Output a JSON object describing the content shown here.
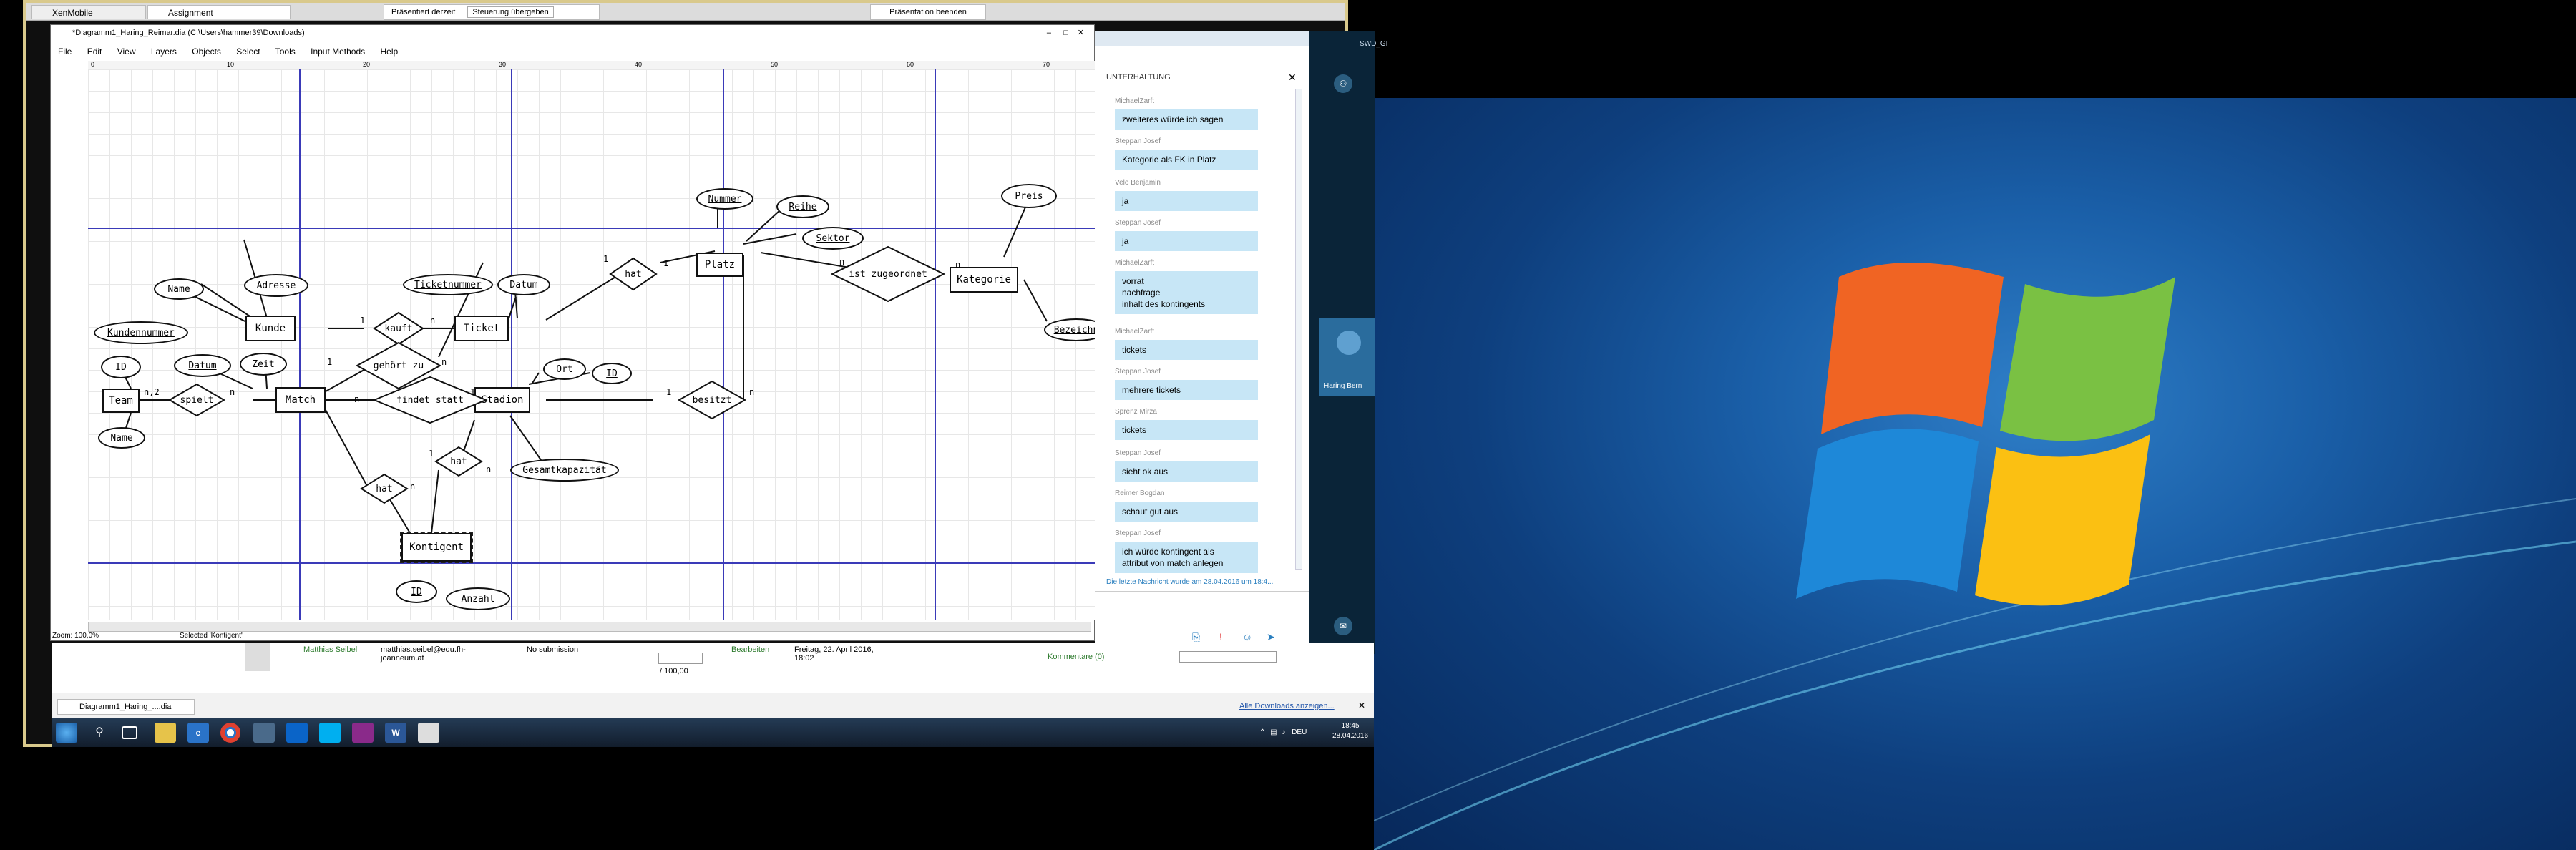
{
  "tabs": [
    "XenMobile",
    "Assignment"
  ],
  "presenter": {
    "label": "Präsentiert derzeit",
    "control": "Steuerung übergeben",
    "end": "Präsentation beenden"
  },
  "dia": {
    "title": "*Diagramm1_Haring_Reimar.dia (C:\\Users\\hammer39\\Downloads)",
    "menu": [
      "File",
      "Edit",
      "View",
      "Layers",
      "Objects",
      "Select",
      "Tools",
      "Input Methods",
      "Help"
    ],
    "ruler": [
      "0",
      "10",
      "20",
      "30",
      "40",
      "50",
      "60",
      "70"
    ],
    "zoom": "Zoom: 100,0%",
    "status": "Selected 'Kontigent'"
  },
  "er": {
    "entities": {
      "team": "Team",
      "match": "Match",
      "kunde": "Kunde",
      "ticket": "Ticket",
      "stadion": "Stadion",
      "platz": "Platz",
      "kategorie": "Kategorie",
      "kontigent": "Kontigent"
    },
    "attributes": {
      "id1": "ID",
      "name1": "Name",
      "datum1": "Datum",
      "zeit": "Zeit",
      "name2": "Name",
      "adresse": "Adresse",
      "kundennummer": "Kundennummer",
      "ticketnummer": "Ticketnummer",
      "datum2": "Datum",
      "ort": "Ort",
      "id2": "ID",
      "gesamtkapazitaet": "Gesamtkapazität",
      "nummer": "Nummer",
      "reihe": "Reihe",
      "sektor": "Sektor",
      "preis": "Preis",
      "bezeichnung": "Bezeichn",
      "id3": "ID",
      "anzahl": "Anzahl"
    },
    "relations": {
      "spielt": "spielt",
      "kauft": "kauft",
      "gehoert": "gehört zu",
      "findet": "findet statt",
      "hat1": "hat",
      "hat2": "hat",
      "hat3": "hat",
      "besitzt": "besitzt",
      "zugeordnet": "ist zugeordnet"
    },
    "cardinalities": [
      "n,2",
      "n",
      "1",
      "n",
      "1",
      "n",
      "1",
      "n",
      "1",
      "n",
      "1",
      "n",
      "1",
      "n",
      "n",
      "1",
      "n",
      "1",
      "n"
    ]
  },
  "chat": {
    "header": "UNTERHALTUNG",
    "messages": [
      {
        "sender": "MichaelZarft",
        "text": "zweiteres würde ich sagen"
      },
      {
        "sender": "Steppan Josef",
        "text": "Kategorie als FK in Platz"
      },
      {
        "sender": "Velo Benjamin",
        "text": "ja"
      },
      {
        "sender": "Steppan Josef",
        "text": "ja"
      },
      {
        "sender": "MichaelZarft",
        "text": "vorrat\nnachfrage\ninhalt des kontingents"
      },
      {
        "sender": "MichaelZarft",
        "text": "tickets"
      },
      {
        "sender": "Steppan Josef",
        "text": "mehrere tickets"
      },
      {
        "sender": "Sprenz Mirza",
        "text": "tickets"
      },
      {
        "sender": "Steppan Josef",
        "text": "sieht ok aus"
      },
      {
        "sender": "Reimer Bogdan",
        "text": "schaut gut aus"
      },
      {
        "sender": "Steppan Josef",
        "text": "ich würde kontingent als\nattribut von match anlegen"
      }
    ],
    "last": "Die letzte Nachricht wurde am 28.04.2016 um 18:4...",
    "participant": "Haring Bern",
    "sidetop": "SWD_GI"
  },
  "moodle": {
    "name": "Matthias Seibel",
    "email": "matthias.seibel@edu.fh-joanneum.at",
    "status": "No submission",
    "grade": "/ 100,00",
    "edit": "Bearbeiten",
    "date": "Freitag, 22. April 2016, 18:02",
    "comments": "Kommentare (0)"
  },
  "download": {
    "file": "Diagramm1_Haring_....dia",
    "all": "Alle Downloads anzeigen..."
  },
  "clock": {
    "lang": "DEU",
    "time": "18:45",
    "date": "28.04.2016"
  }
}
